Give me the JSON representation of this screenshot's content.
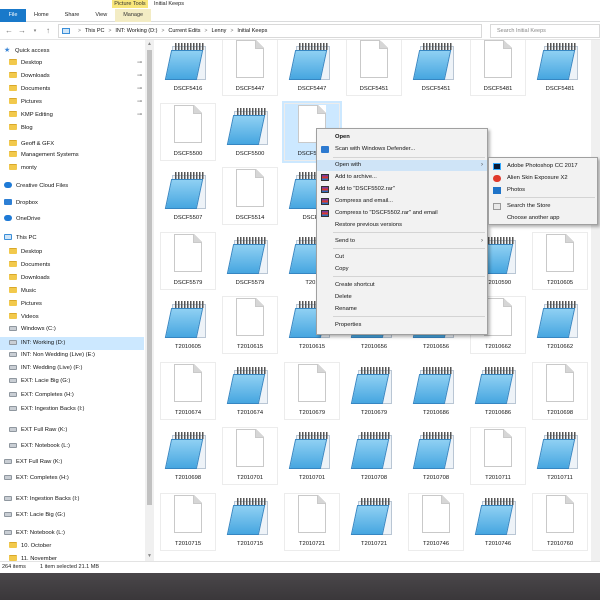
{
  "window": {
    "context_tab": "Picture Tools",
    "title": "Initial Keeps",
    "tabs": [
      "File",
      "Home",
      "Share",
      "View",
      "Manage"
    ]
  },
  "address": {
    "crumbs": [
      "This PC",
      "INT: Working (D:)",
      "Current Edits",
      "Lenny",
      "Initial Keeps"
    ],
    "search_placeholder": "Search Initial Keeps"
  },
  "sidebar": {
    "items": [
      {
        "label": "Quick access",
        "icon": "star-icon",
        "pinned": false
      },
      {
        "label": "Desktop",
        "icon": "folder-icon",
        "pinned": true
      },
      {
        "label": "Downloads",
        "icon": "folder-icon",
        "pinned": true
      },
      {
        "label": "Documents",
        "icon": "folder-icon",
        "pinned": true
      },
      {
        "label": "Pictures",
        "icon": "folder-icon",
        "pinned": true
      },
      {
        "label": "KMP Editing",
        "icon": "folder-icon",
        "pinned": true
      },
      {
        "label": "Blog",
        "icon": "folder-icon",
        "pinned": false
      },
      {
        "label": "Geoff & GFX",
        "icon": "folder-icon",
        "pinned": false
      },
      {
        "label": "Management Systems",
        "icon": "folder-icon",
        "pinned": false
      },
      {
        "label": "monty",
        "icon": "folder-icon",
        "pinned": false
      },
      {
        "label": "Creative Cloud Files",
        "icon": "cloud-icon",
        "pinned": false
      },
      {
        "label": "Dropbox",
        "icon": "dropbox-icon",
        "pinned": false
      },
      {
        "label": "OneDrive",
        "icon": "cloud-icon",
        "pinned": false
      },
      {
        "label": "This PC",
        "icon": "pc-icon",
        "pinned": false
      },
      {
        "label": "Desktop",
        "icon": "folder-icon",
        "pinned": false
      },
      {
        "label": "Documents",
        "icon": "folder-icon",
        "pinned": false
      },
      {
        "label": "Downloads",
        "icon": "folder-icon",
        "pinned": false
      },
      {
        "label": "Music",
        "icon": "folder-icon",
        "pinned": false
      },
      {
        "label": "Pictures",
        "icon": "folder-icon",
        "pinned": false
      },
      {
        "label": "Videos",
        "icon": "folder-icon",
        "pinned": false
      },
      {
        "label": "Windows (C:)",
        "icon": "drive-icon",
        "pinned": false
      },
      {
        "label": "INT: Working (D:)",
        "icon": "drive-icon",
        "pinned": false,
        "selected": true
      },
      {
        "label": "INT: Non Wedding (Live) (E:)",
        "icon": "drive-icon",
        "pinned": false
      },
      {
        "label": "INT: Wedding (Live) (F:)",
        "icon": "drive-icon",
        "pinned": false
      },
      {
        "label": "EXT: Lacie Big (G:)",
        "icon": "drive-icon",
        "pinned": false
      },
      {
        "label": "EXT: Completes (H:)",
        "icon": "drive-icon",
        "pinned": false
      },
      {
        "label": "EXT: Ingestion Backs (I:)",
        "icon": "drive-icon",
        "pinned": false
      },
      {
        "label": "EXT Full Raw (K:)",
        "icon": "drive-icon",
        "pinned": false
      },
      {
        "label": "EXT: Notebook (L:)",
        "icon": "drive-icon",
        "pinned": false
      },
      {
        "label": "EXT Full Raw (K:)",
        "icon": "drive-icon",
        "pinned": false
      },
      {
        "label": "EXT: Completes (H:)",
        "icon": "drive-icon",
        "pinned": false
      },
      {
        "label": "EXT: Ingestion Backs (I:)",
        "icon": "drive-icon",
        "pinned": false
      },
      {
        "label": "EXT: Lacie Big (G:)",
        "icon": "drive-icon",
        "pinned": false
      },
      {
        "label": "EXT: Notebook (L:)",
        "icon": "drive-icon",
        "pinned": false
      },
      {
        "label": "10. October",
        "icon": "folder-icon",
        "pinned": false
      },
      {
        "label": "11. November",
        "icon": "folder-icon",
        "pinned": false
      }
    ]
  },
  "files": [
    [
      "DSCF5416",
      "DSCF5447",
      "DSCF5447",
      "DSCF5451",
      "DSCF5451",
      "DSCF5481",
      "DSCF5481"
    ],
    [
      "DSCF5500",
      "DSCF5500",
      "DSCF5502",
      "",
      "",
      "",
      ""
    ],
    [
      "DSCF5507",
      "DSCF5514",
      "DSCF5",
      "",
      "",
      "DSCF5550",
      "DSCF5556"
    ],
    [
      "DSCF5579",
      "DSCF5579",
      "T201",
      "",
      "",
      "T2010590",
      "T2010605"
    ],
    [
      "T2010605",
      "T2010615",
      "T2010615",
      "T2010656",
      "T2010656",
      "T2010662",
      "T2010662"
    ],
    [
      "T2010674",
      "T2010674",
      "T2010679",
      "T2010679",
      "T2010686",
      "T2010686",
      "T2010698"
    ],
    [
      "T2010698",
      "T2010701",
      "T2010701",
      "T2010708",
      "T2010708",
      "T2010711",
      "T2010711"
    ],
    [
      "T2010715",
      "T2010715",
      "T2010721",
      "T2010721",
      "T2010746",
      "T2010746",
      "T2010760"
    ]
  ],
  "context_menu": {
    "items": [
      "Open",
      "Scan with Windows Defender...",
      "Open with",
      "Add to archive...",
      "Add to \"DSCF5502.rar\"",
      "Compress and email...",
      "Compress to \"DSCF5502.rar\" and email",
      "Restore previous versions",
      "Send to",
      "Cut",
      "Copy",
      "Create shortcut",
      "Delete",
      "Rename",
      "Properties"
    ]
  },
  "open_with_menu": {
    "items": [
      "Adobe Photoshop CC 2017",
      "Alien Skin Exposure X2",
      "Photos",
      "Search the Store",
      "Choose another app"
    ]
  },
  "status": {
    "count": "264 items",
    "selection": "1 item selected  21.1 MB"
  },
  "colors": {
    "accent": "#1979ca",
    "selection": "#cce8ff",
    "picture_tools": "#f8e67a"
  }
}
